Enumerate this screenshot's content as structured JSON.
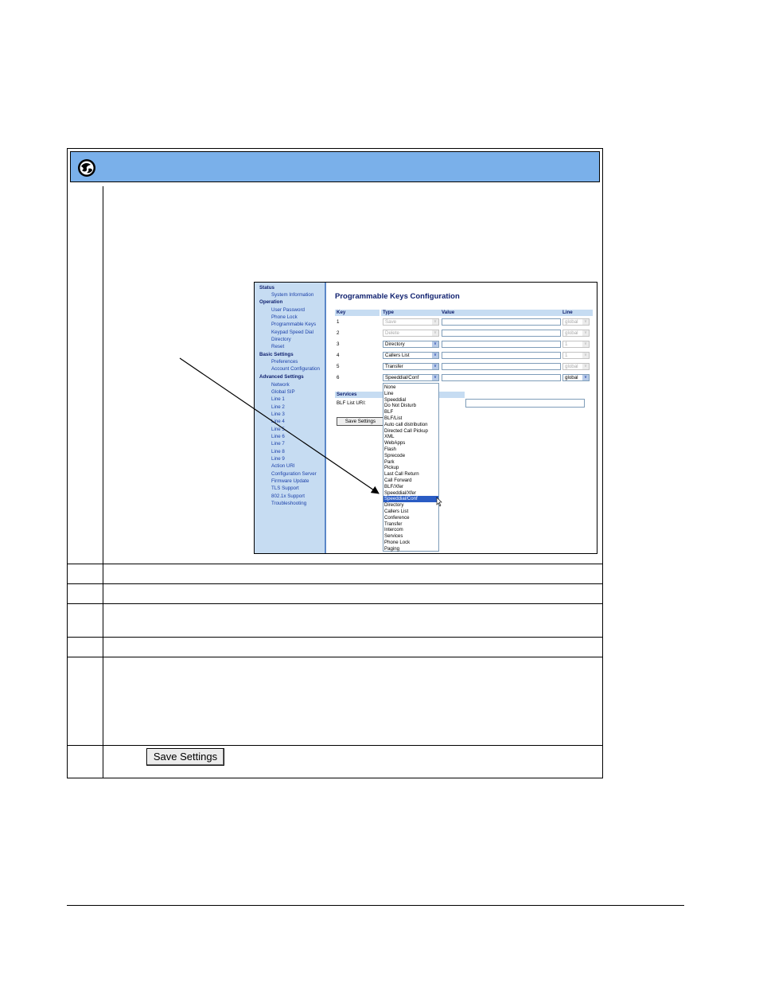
{
  "screenshot": {
    "sidebar": [
      {
        "label": "Status",
        "heading": true
      },
      {
        "label": "System Information",
        "heading": false
      },
      {
        "label": "Operation",
        "heading": true
      },
      {
        "label": "User Password",
        "heading": false
      },
      {
        "label": "Phone Lock",
        "heading": false
      },
      {
        "label": "Programmable Keys",
        "heading": false
      },
      {
        "label": "Keypad Speed Dial",
        "heading": false
      },
      {
        "label": "Directory",
        "heading": false
      },
      {
        "label": "Reset",
        "heading": false
      },
      {
        "label": "Basic Settings",
        "heading": true
      },
      {
        "label": "Preferences",
        "heading": false
      },
      {
        "label": "Account Configuration",
        "heading": false
      },
      {
        "label": "Advanced Settings",
        "heading": true
      },
      {
        "label": "Network",
        "heading": false
      },
      {
        "label": "Global SIP",
        "heading": false
      },
      {
        "label": "Line 1",
        "heading": false
      },
      {
        "label": "Line 2",
        "heading": false
      },
      {
        "label": "Line 3",
        "heading": false
      },
      {
        "label": "Line 4",
        "heading": false
      },
      {
        "label": "Line 5",
        "heading": false
      },
      {
        "label": "Line 6",
        "heading": false
      },
      {
        "label": "Line 7",
        "heading": false
      },
      {
        "label": "Line 8",
        "heading": false
      },
      {
        "label": "Line 9",
        "heading": false
      },
      {
        "label": "Action URI",
        "heading": false
      },
      {
        "label": "Configuration Server",
        "heading": false
      },
      {
        "label": "Firmware Update",
        "heading": false
      },
      {
        "label": "TLS Support",
        "heading": false
      },
      {
        "label": "802.1x Support",
        "heading": false
      },
      {
        "label": "Troubleshooting",
        "heading": false
      }
    ],
    "title": "Programmable Keys Configuration",
    "columns": {
      "key": "Key",
      "type": "Type",
      "value": "Value",
      "line": "Line"
    },
    "rows": [
      {
        "key": "1",
        "type": "Save",
        "line": "global",
        "type_enabled": false,
        "line_enabled": false
      },
      {
        "key": "2",
        "type": "Delete",
        "line": "global",
        "type_enabled": false,
        "line_enabled": false
      },
      {
        "key": "3",
        "type": "Directory",
        "line": "1",
        "type_enabled": true,
        "line_enabled": false
      },
      {
        "key": "4",
        "type": "Callers List",
        "line": "1",
        "type_enabled": true,
        "line_enabled": false
      },
      {
        "key": "5",
        "type": "Transfer",
        "line": "global",
        "type_enabled": true,
        "line_enabled": false
      },
      {
        "key": "6",
        "type": "Speeddial/Conf",
        "line": "global",
        "type_enabled": true,
        "line_enabled": true
      }
    ],
    "dropdown_options": [
      "None",
      "Line",
      "Speeddial",
      "Do Not Disturb",
      "BLF",
      "BLF/List",
      "Auto call distribution",
      "Directed Call Pickup",
      "XML",
      "WebApps",
      "Flash",
      "Sprecode",
      "Park",
      "Pickup",
      "Last Call Return",
      "Call Forward",
      "BLF/Xfer",
      "Speeddial/Xfer",
      "Speeddial/Conf",
      "Directory",
      "Callers List",
      "Conference",
      "Transfer",
      "Intercom",
      "Services",
      "Phone Lock",
      "Paging"
    ],
    "dropdown_selected": "Speeddial/Conf",
    "services_heading": "Services",
    "blf_list_label": "BLF List URI:",
    "save_label": "Save Settings"
  },
  "step_save_button_label": "Save Settings"
}
